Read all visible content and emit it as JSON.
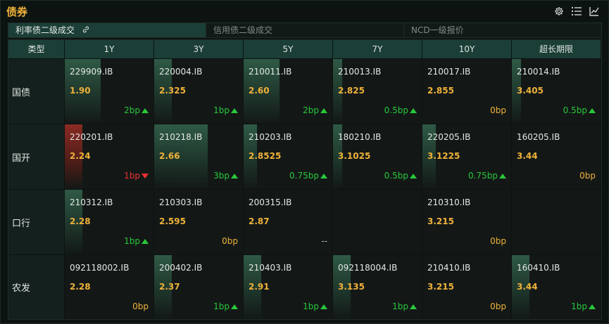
{
  "title": "债券",
  "toolbar": {
    "icons": [
      "gear-icon",
      "list-icon",
      "chart-icon"
    ]
  },
  "tabs": [
    {
      "label": "利率债二级成交",
      "active": true,
      "icon": "link-icon"
    },
    {
      "label": "信用债二级成交",
      "active": false
    },
    {
      "label": "NCD一级报价",
      "active": false
    }
  ],
  "table": {
    "type_header": "类型",
    "columns": [
      "1Y",
      "3Y",
      "5Y",
      "7Y",
      "10Y",
      "超长期限"
    ],
    "rows": [
      {
        "type": "国债",
        "cells": [
          {
            "code": "229909.IB",
            "yield": "1.90",
            "change": "2bp",
            "dir": "up",
            "bar": 0.4,
            "bar_color": "g"
          },
          {
            "code": "220004.IB",
            "yield": "2.325",
            "change": "1bp",
            "dir": "up",
            "bar": 0.2,
            "bar_color": "g"
          },
          {
            "code": "210011.IB",
            "yield": "2.60",
            "change": "2bp",
            "dir": "up",
            "bar": 0.4,
            "bar_color": "g"
          },
          {
            "code": "210013.IB",
            "yield": "2.825",
            "change": "0.5bp",
            "dir": "up",
            "bar": 0.1,
            "bar_color": "g"
          },
          {
            "code": "210017.IB",
            "yield": "2.855",
            "change": "0bp",
            "dir": "flat",
            "bar": 0,
            "bar_color": "g"
          },
          {
            "code": "210014.IB",
            "yield": "3.405",
            "change": "0.5bp",
            "dir": "up",
            "bar": 0.1,
            "bar_color": "g"
          }
        ]
      },
      {
        "type": "国开",
        "cells": [
          {
            "code": "220201.IB",
            "yield": "2.24",
            "change": "1bp",
            "dir": "down",
            "bar": 0.2,
            "bar_color": "r"
          },
          {
            "code": "210218.IB",
            "yield": "2.66",
            "change": "3bp",
            "dir": "up",
            "bar": 0.6,
            "bar_color": "g"
          },
          {
            "code": "210203.IB",
            "yield": "2.8525",
            "change": "0.75bp",
            "dir": "up",
            "bar": 0.15,
            "bar_color": "g"
          },
          {
            "code": "180210.IB",
            "yield": "3.1025",
            "change": "0.5bp",
            "dir": "up",
            "bar": 0.1,
            "bar_color": "g"
          },
          {
            "code": "220205.IB",
            "yield": "3.1225",
            "change": "0.75bp",
            "dir": "up",
            "bar": 0.15,
            "bar_color": "g"
          },
          {
            "code": "160205.IB",
            "yield": "3.44",
            "change": "0bp",
            "dir": "flat",
            "bar": 0,
            "bar_color": "g"
          }
        ]
      },
      {
        "type": "口行",
        "cells": [
          {
            "code": "210312.IB",
            "yield": "2.28",
            "change": "1bp",
            "dir": "up",
            "bar": 0.2,
            "bar_color": "g"
          },
          {
            "code": "210303.IB",
            "yield": "2.595",
            "change": "0bp",
            "dir": "flat",
            "bar": 0,
            "bar_color": "g"
          },
          {
            "code": "200315.IB",
            "yield": "2.87",
            "change": "--",
            "dir": "na",
            "bar": 0,
            "bar_color": "g"
          },
          {
            "code": "",
            "yield": "",
            "change": "",
            "dir": "none",
            "bar": 0,
            "bar_color": "g"
          },
          {
            "code": "210310.IB",
            "yield": "3.215",
            "change": "0bp",
            "dir": "flat",
            "bar": 0,
            "bar_color": "g"
          },
          {
            "code": "",
            "yield": "",
            "change": "",
            "dir": "none",
            "bar": 0,
            "bar_color": "g"
          }
        ]
      },
      {
        "type": "农发",
        "cells": [
          {
            "code": "092118002.IB",
            "yield": "2.28",
            "change": "0bp",
            "dir": "flat",
            "bar": 0,
            "bar_color": "g"
          },
          {
            "code": "200402.IB",
            "yield": "2.37",
            "change": "1bp",
            "dir": "up",
            "bar": 0.2,
            "bar_color": "g"
          },
          {
            "code": "210403.IB",
            "yield": "2.91",
            "change": "1bp",
            "dir": "up",
            "bar": 0.2,
            "bar_color": "g"
          },
          {
            "code": "092118004.IB",
            "yield": "3.135",
            "change": "1bp",
            "dir": "up",
            "bar": 0.2,
            "bar_color": "g"
          },
          {
            "code": "210410.IB",
            "yield": "3.215",
            "change": "0bp",
            "dir": "flat",
            "bar": 0,
            "bar_color": "g"
          },
          {
            "code": "160410.IB",
            "yield": "3.44",
            "change": "1bp",
            "dir": "up",
            "bar": 0.2,
            "bar_color": "g"
          }
        ]
      }
    ]
  },
  "colors": {
    "accent": "#f0b23a",
    "up": "#29c83a",
    "down": "#f03030",
    "header_bg": "#1b3e37"
  }
}
